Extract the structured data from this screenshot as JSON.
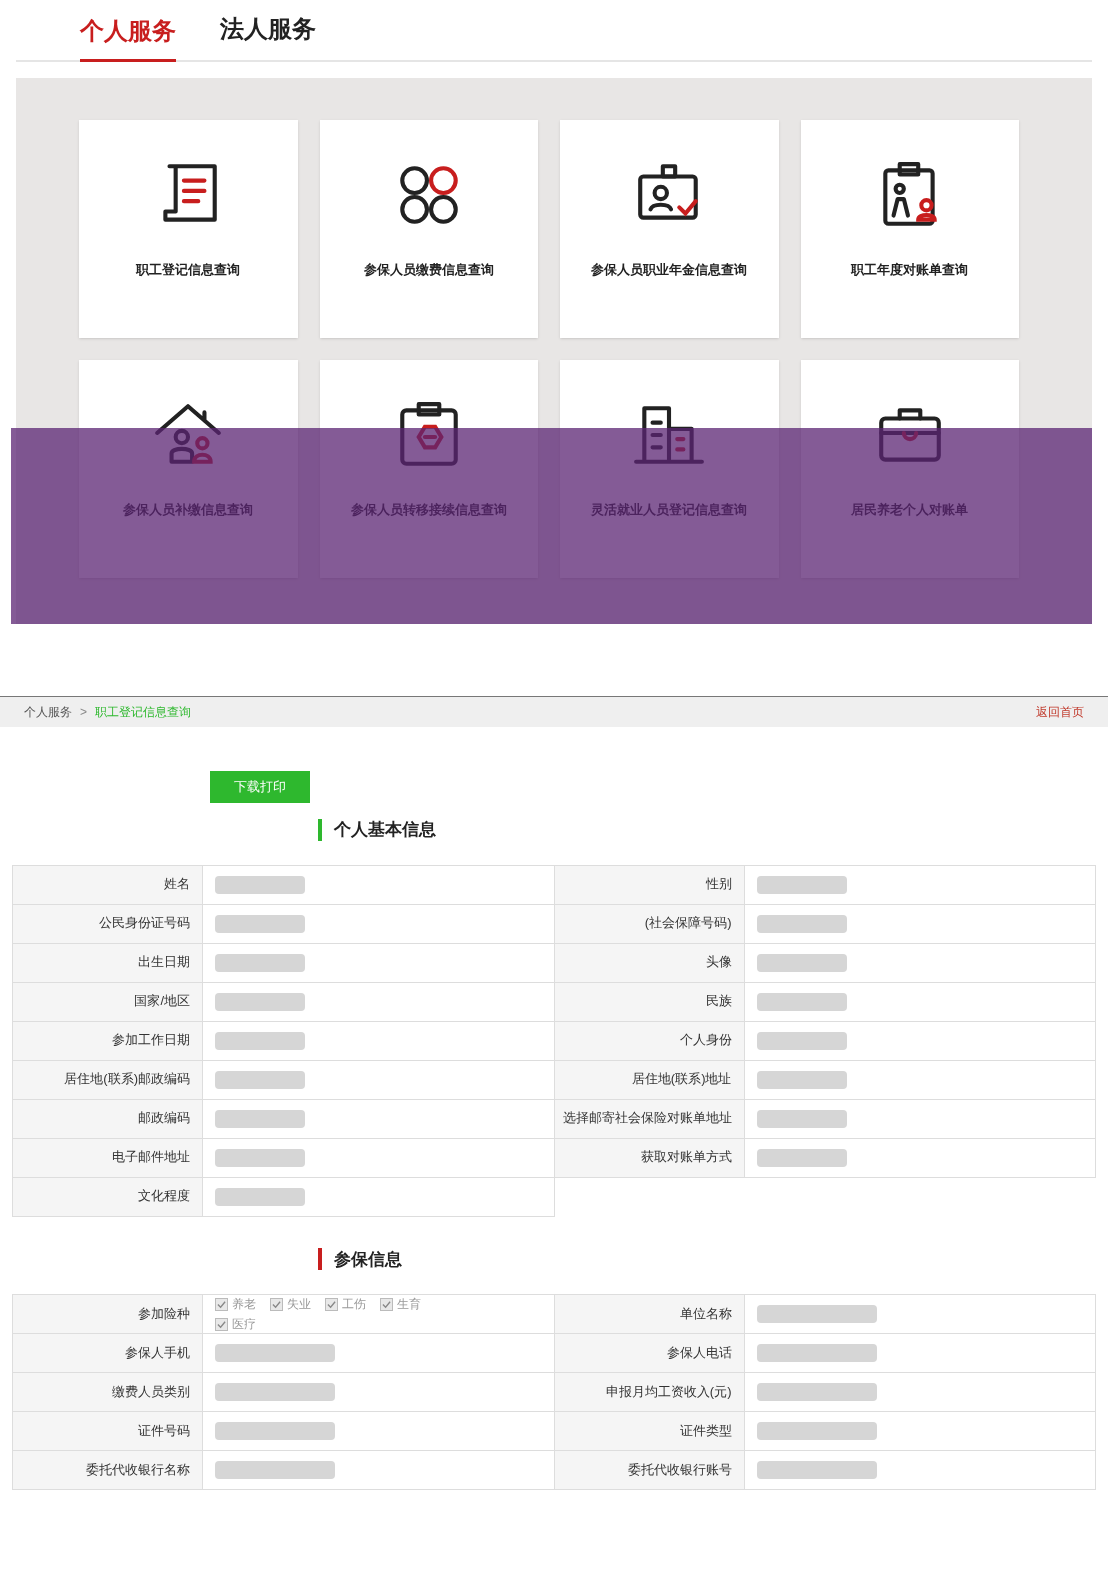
{
  "tabs": [
    {
      "label": "个人服务",
      "selected": true
    },
    {
      "label": "法人服务",
      "selected": false
    }
  ],
  "services": [
    {
      "label": "职工登记信息查询"
    },
    {
      "label": "参保人员缴费信息查询"
    },
    {
      "label": "参保人员职业年金信息查询"
    },
    {
      "label": "职工年度对账单查询"
    },
    {
      "label": "参保人员补缴信息查询"
    },
    {
      "label": "参保人员转移接续信息查询"
    },
    {
      "label": "灵活就业人员登记信息查询"
    },
    {
      "label": "居民养老个人对账单"
    }
  ],
  "breadcrumb": {
    "items": [
      "个人服务",
      "职工登记信息查询"
    ],
    "separator": ">",
    "home_link": "返回首页"
  },
  "download_button": "下载打印",
  "basic_info": {
    "title": "个人基本信息",
    "fields": [
      {
        "label": "姓名"
      },
      {
        "label": "性别"
      },
      {
        "label": "公民身份证号码"
      },
      {
        "label": "(社会保障号码)"
      },
      {
        "label": "出生日期"
      },
      {
        "label": "头像"
      },
      {
        "label": "国家/地区"
      },
      {
        "label": "民族"
      },
      {
        "label": "参加工作日期"
      },
      {
        "label": "个人身份"
      },
      {
        "label": "居住地(联系)邮政编码"
      },
      {
        "label": "居住地(联系)地址"
      },
      {
        "label": "邮政编码"
      },
      {
        "label": "选择邮寄社会保险对账单地址"
      },
      {
        "label": "电子邮件地址"
      },
      {
        "label": "获取对账单方式"
      },
      {
        "label": "文化程度"
      }
    ]
  },
  "insurance_info": {
    "title": "参保信息",
    "fields": [
      {
        "kind": "checkboxes",
        "label": "参加险种",
        "options": [
          {
            "label": "养老",
            "checked": true
          },
          {
            "label": "失业",
            "checked": true
          },
          {
            "label": "工伤",
            "checked": true
          },
          {
            "label": "生育",
            "checked": true
          },
          {
            "label": "医疗",
            "checked": true
          }
        ]
      },
      {
        "kind": "text",
        "label": "单位名称"
      },
      {
        "kind": "text",
        "label": "参保人手机"
      },
      {
        "kind": "text",
        "label": "参保人电话"
      },
      {
        "kind": "text",
        "label": "缴费人员类别"
      },
      {
        "kind": "text",
        "label": "申报月均工资收入(元)"
      },
      {
        "kind": "text",
        "label": "证件号码"
      },
      {
        "kind": "text",
        "label": "证件类型"
      },
      {
        "kind": "text",
        "label": "委托代收银行名称"
      },
      {
        "kind": "text",
        "label": "委托代收银行账号"
      }
    ]
  }
}
